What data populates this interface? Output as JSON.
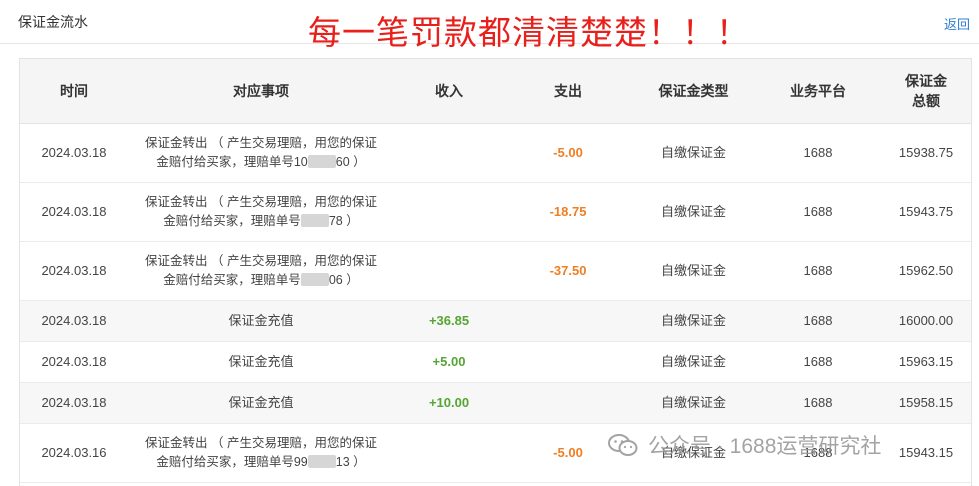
{
  "header": {
    "title": "保证金流水",
    "overlay": "每一笔罚款都清清楚楚！！！",
    "back": "返回"
  },
  "table": {
    "columns": [
      "时间",
      "对应事项",
      "收入",
      "支出",
      "保证金类型",
      "业务平台",
      "保证金\n总额"
    ],
    "rows": [
      {
        "time": "2024.03.18",
        "item_line1": "保证金转出 （ 产生交易理赔，用您的保证",
        "item_pre": "金赔付给买家，理赔单号10",
        "item_post": "60 ）",
        "income": "",
        "expense": "-5.00",
        "type": "自缴保证金",
        "platform": "1688",
        "total": "15938.75"
      },
      {
        "time": "2024.03.18",
        "item_line1": "保证金转出 （ 产生交易理赔，用您的保证",
        "item_pre": "金赔付给买家，理赔单号",
        "item_post": "78 ）",
        "income": "",
        "expense": "-18.75",
        "type": "自缴保证金",
        "platform": "1688",
        "total": "15943.75"
      },
      {
        "time": "2024.03.18",
        "item_line1": "保证金转出 （ 产生交易理赔，用您的保证",
        "item_pre": "金赔付给买家，理赔单号",
        "item_post": "06 ）",
        "income": "",
        "expense": "-37.50",
        "type": "自缴保证金",
        "platform": "1688",
        "total": "15962.50"
      },
      {
        "time": "2024.03.18",
        "item": "保证金充值",
        "income": "+36.85",
        "expense": "",
        "type": "自缴保证金",
        "platform": "1688",
        "total": "16000.00"
      },
      {
        "time": "2024.03.18",
        "item": "保证金充值",
        "income": "+5.00",
        "expense": "",
        "type": "自缴保证金",
        "platform": "1688",
        "total": "15963.15"
      },
      {
        "time": "2024.03.18",
        "item": "保证金充值",
        "income": "+10.00",
        "expense": "",
        "type": "自缴保证金",
        "platform": "1688",
        "total": "15958.15"
      },
      {
        "time": "2024.03.16",
        "item_line1": "保证金转出 （ 产生交易理赔，用您的保证",
        "item_pre": "金赔付给买家，理赔单号99",
        "item_post": "13 ）",
        "income": "",
        "expense": "-5.00",
        "type": "自缴保证金",
        "platform": "1688",
        "total": "15943.15"
      }
    ]
  },
  "watermark": {
    "text": "公众号 · 1688运营研究社"
  },
  "colors": {
    "overlay": "#e8201c",
    "negative": "#f07e22",
    "positive": "#55a532",
    "link": "#2d7dd2"
  }
}
